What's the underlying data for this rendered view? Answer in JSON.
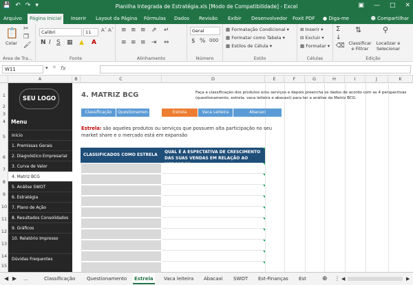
{
  "window": {
    "title": "Planilha Integrada de Estratégia.xls  [Modo de Compatibilidade]  -  Excel",
    "qat_save_icon": "save-icon",
    "qat_undo_icon": "undo-icon",
    "qat_redo_icon": "redo-icon",
    "min_icon": "minimize-icon",
    "max_icon": "maximize-icon",
    "close_icon": "close-icon"
  },
  "ribbon_tabs": [
    "Arquivo",
    "Página Inicial",
    "Inserir",
    "Layout da Página",
    "Fórmulas",
    "Dados",
    "Revisão",
    "Exibir",
    "Desenvolvedor",
    "Foxit PDF",
    "Diga-me",
    "Compartilhar"
  ],
  "ribbon": {
    "clipboard": {
      "paste": "Colar",
      "group": "Área de Tra..."
    },
    "font": {
      "name": "Calibri",
      "size": "11",
      "group": "Fonte"
    },
    "alignment": {
      "group": "Alinhamento"
    },
    "number": {
      "format": "Geral",
      "group": "Número"
    },
    "styles": {
      "conditional": "Formatação Condicional",
      "table": "Formatar como Tabela",
      "cell": "Estilos de Célula",
      "group": "Estilo"
    },
    "cells": {
      "insert": "Inserir",
      "delete": "Excluir",
      "format": "Formatar",
      "group": "Células"
    },
    "editing": {
      "sort": "Classificar e Filtrar",
      "find": "Localizar e Selecionar",
      "group": "Edição"
    }
  },
  "formula_bar": {
    "name_box": "W11",
    "fx": "fx"
  },
  "columns": [
    "A",
    "B",
    "C",
    "D",
    "E",
    "F",
    "G",
    "H",
    "I",
    "J",
    "K"
  ],
  "rows": [
    "1",
    "2",
    "3",
    "4",
    "5",
    "6",
    "7",
    "8",
    "9",
    "10",
    "11",
    "12",
    "13",
    "14",
    "15"
  ],
  "sidebar": {
    "logo": "SEU LOGO",
    "menu_title": "Menu",
    "items": [
      "Início",
      "1. Premissas Gerais",
      "2. Diagnóstico Empresarial",
      "3. Curva de Valor",
      "4. Matriz BCG",
      "5. Análise SWOT",
      "6. Estratégia",
      "7. Plano de Ação",
      "8. Resultados Consolidados",
      "9. Gráficos",
      "10. Relatório Impresso",
      "Dúvidas Frequentes"
    ]
  },
  "content": {
    "heading": "4. MATRIZ BCG",
    "description": "Faça a classificação dos produtos e/ou serviços e depois preencha os dados de acordo com as 4 perspectivas (questionamento, estrela, vaca leiteira e abacaxi) para ter a análise da Matriz BCG.",
    "nav_buttons": [
      "Classificação",
      "Questionamen",
      "Estrela",
      "Vaca Leiteira",
      "Abacaxi"
    ],
    "definition_term": "Estrela:",
    "definition_text": " são aqueles produtos ou serviços que possuem alta participação no seu market share e o mercado está em expansão",
    "table_headers": [
      "CLASSIFICADOS COMO ESTRELA",
      "QUAL É A ESPECTATIVA DE CRESCIMENTO DAS SUAS VENDAS EM RELAÇÃO AO MERCADO?"
    ]
  },
  "sheet_tabs": [
    "...",
    "Classificação",
    "Questionamento",
    "Estrela",
    "Vaca leiteira",
    "Abacaxi",
    "SWOT",
    "Est-Finanças",
    "Est"
  ],
  "colors": {
    "excel_green": "#217346",
    "sidebar_bg": "#262626",
    "nav_blue": "#5b9bd5",
    "nav_orange": "#ed7d31",
    "table_header": "#1f4e79",
    "accent_red": "#c00000"
  }
}
